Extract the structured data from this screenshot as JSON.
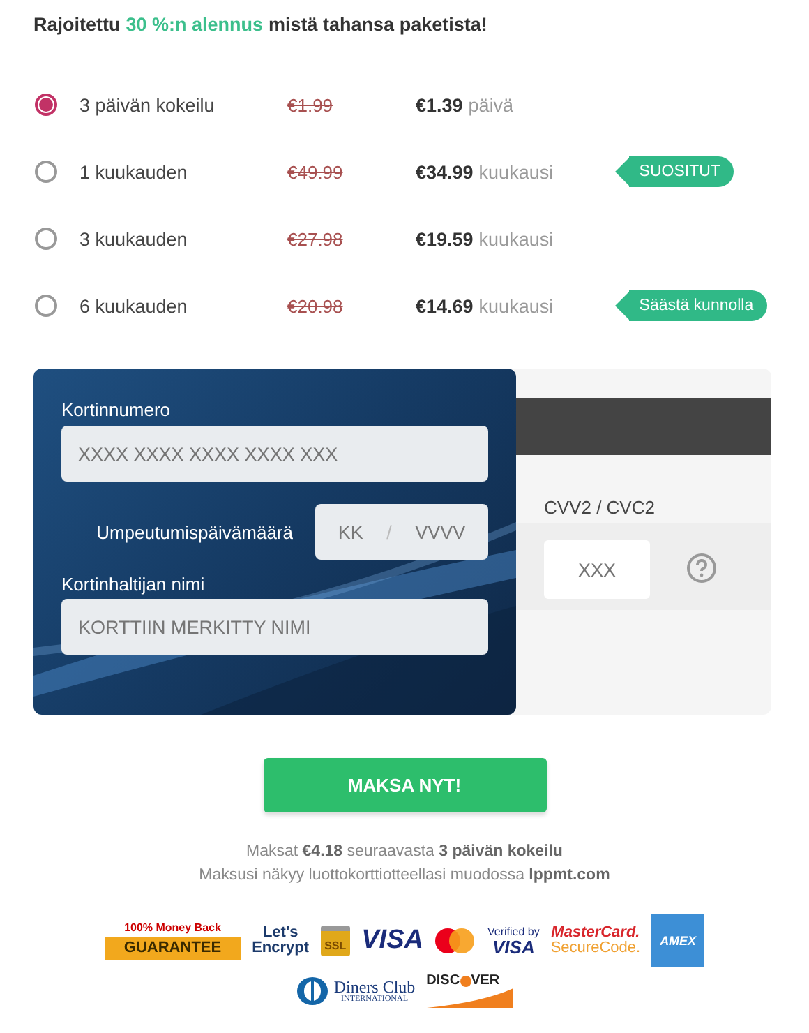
{
  "headline": {
    "before": "Rajoitettu",
    "highlight": "30 %:n alennus",
    "after": "mistä tahansa paketista!"
  },
  "plans": [
    {
      "name": "3 päivän kokeilu",
      "old_price": "€1.99",
      "price": "€1.39",
      "period": "päivä",
      "selected": true
    },
    {
      "name": "1 kuukauden",
      "old_price": "€49.99",
      "price": "€34.99",
      "period": "kuukausi",
      "selected": false,
      "tag": "SUOSITUT"
    },
    {
      "name": "3 kuukauden",
      "old_price": "€27.98",
      "price": "€19.59",
      "period": "kuukausi",
      "selected": false
    },
    {
      "name": "6 kuukauden",
      "old_price": "€20.98",
      "price": "€14.69",
      "period": "kuukausi",
      "selected": false,
      "tag": "Säästä kunnolla"
    }
  ],
  "card": {
    "number_label": "Kortinnumero",
    "number_placeholder": "XXXX XXXX XXXX XXXX XXX",
    "expiry_label": "Umpeutumispäivämäärä",
    "month_placeholder": "KK",
    "separator": "/",
    "year_placeholder": "VVVV",
    "name_label": "Kortinhaltijan nimi",
    "name_placeholder": "KORTTIIN MERKITTY NIMI",
    "cvv_label": "CVV2 / CVC2",
    "cvv_placeholder": "XXX"
  },
  "pay_button": "MAKSA NYT!",
  "notes": [
    "Maksat **€4.18** seuraavasta **3 päivän kokeilu**",
    "Maksusi näkyy luottokorttiotteellasi muodossa **lppmt.com**"
  ],
  "logos": [
    {
      "kind": "guarantee",
      "top": "100% Money Back",
      "main": "GUARANTEE"
    },
    {
      "kind": "letsencrypt",
      "top": "Let's",
      "main": "Encrypt"
    },
    {
      "kind": "ssl",
      "main": "SSL"
    },
    {
      "kind": "visa",
      "main": "VISA"
    },
    {
      "kind": "mastercard"
    },
    {
      "kind": "verified",
      "top": "Verified by",
      "main": "VISA"
    },
    {
      "kind": "securecode",
      "top": "MasterCard.",
      "main": "SecureCode."
    },
    {
      "kind": "amex",
      "main": "AMEX"
    },
    {
      "kind": "diners",
      "top": "Diners Club",
      "main": "INTERNATIONAL"
    },
    {
      "kind": "discover",
      "top": "DISC",
      "main": "VER"
    }
  ]
}
